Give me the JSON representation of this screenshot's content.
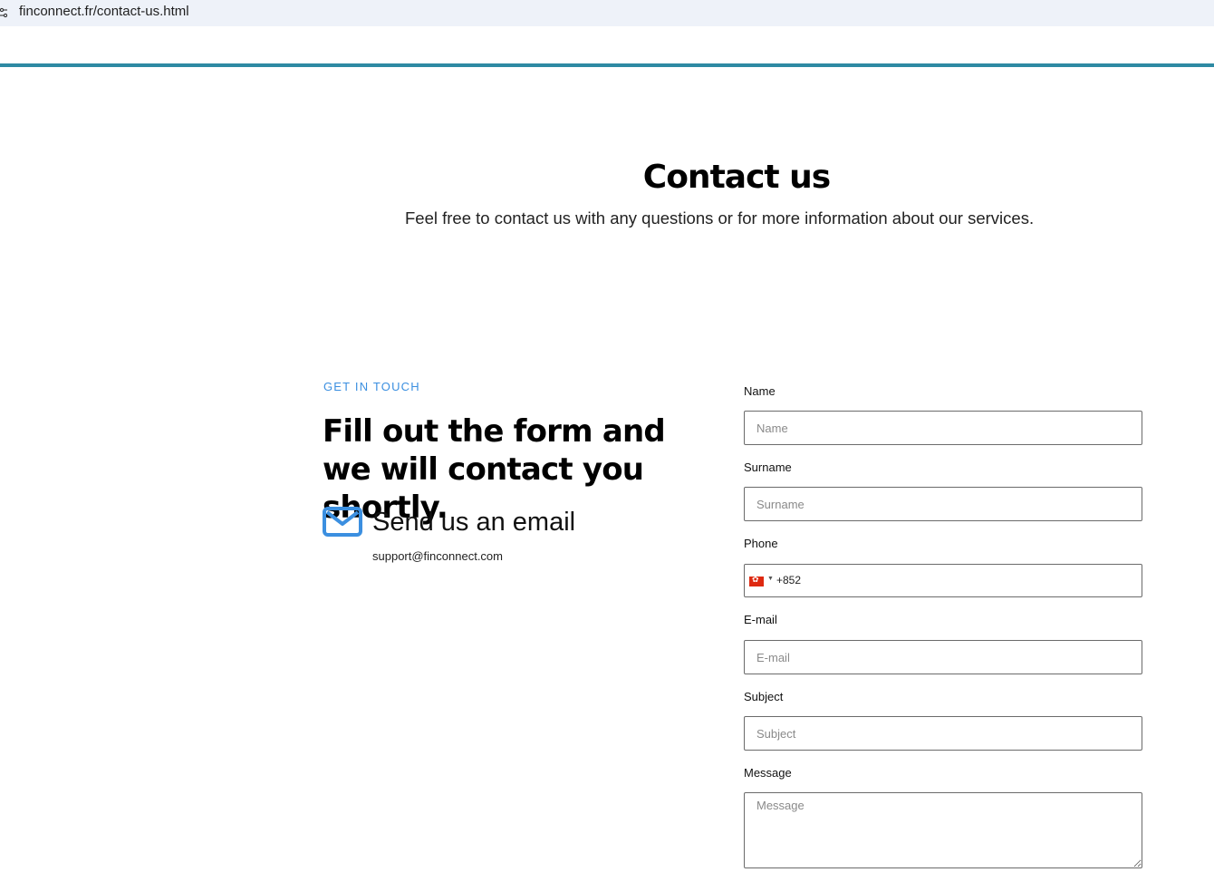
{
  "browser": {
    "url": "finconnect.fr/contact-us.html",
    "site_info_icon": "tune-icon"
  },
  "hero": {
    "title": "Contact us",
    "subtitle": "Feel free to contact us with any questions or for more information about our services."
  },
  "info": {
    "eyebrow": "GET IN TOUCH",
    "heading": "Fill out the form and we will contact you shortly.",
    "email_heading": "Send us an email",
    "email_address": "support@finconnect.com",
    "email_icon": "envelope-icon",
    "icon_color": "#3b8fe0"
  },
  "form": {
    "name": {
      "label": "Name",
      "placeholder": "Name"
    },
    "surname": {
      "label": "Surname",
      "placeholder": "Surname"
    },
    "phone": {
      "label": "Phone",
      "country_code": "+852",
      "flag": "hong-kong-flag-icon"
    },
    "email": {
      "label": "E-mail",
      "placeholder": "E-mail"
    },
    "subject": {
      "label": "Subject",
      "placeholder": "Subject"
    },
    "message": {
      "label": "Message",
      "placeholder": "Message"
    }
  },
  "colors": {
    "accent_line": "#2e8aa3",
    "eyebrow": "#3b8fe0"
  }
}
